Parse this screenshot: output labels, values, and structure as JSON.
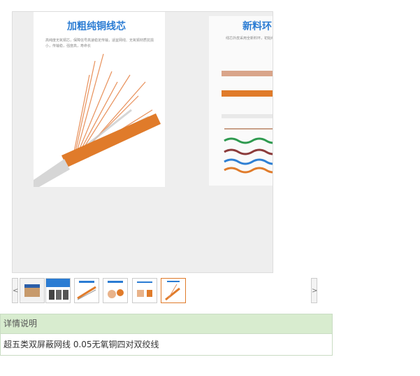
{
  "gallery": {
    "slides": [
      {
        "title": "加粗纯铜线芯",
        "description": "高纯度无氧铜芯，保障信号高速稳定传输，适宜网线、无氧铜材质抗损小，传输稳，强度高，寿命长"
      },
      {
        "title": "新料环",
        "description": "线芯外皮采用全新料环，初始线缆寿命，色泽鲜"
      }
    ],
    "prev_label": "<",
    "next_label": ">",
    "thumbnails": [
      {
        "name": "cable-box",
        "active": false
      },
      {
        "name": "product-banner",
        "active": false
      },
      {
        "name": "cable-diagram",
        "active": false
      },
      {
        "name": "cable-cross-section",
        "active": false
      },
      {
        "name": "cable-features",
        "active": false
      },
      {
        "name": "copper-core",
        "active": true
      }
    ]
  },
  "detail": {
    "header": "详情说明",
    "body": "超五类双屏蔽网线 0.05无氧铜四对双绞线"
  },
  "colors": {
    "accent_orange": "#e07b2a",
    "title_blue": "#2b7cd3",
    "detail_header_bg": "#d8eccf"
  }
}
